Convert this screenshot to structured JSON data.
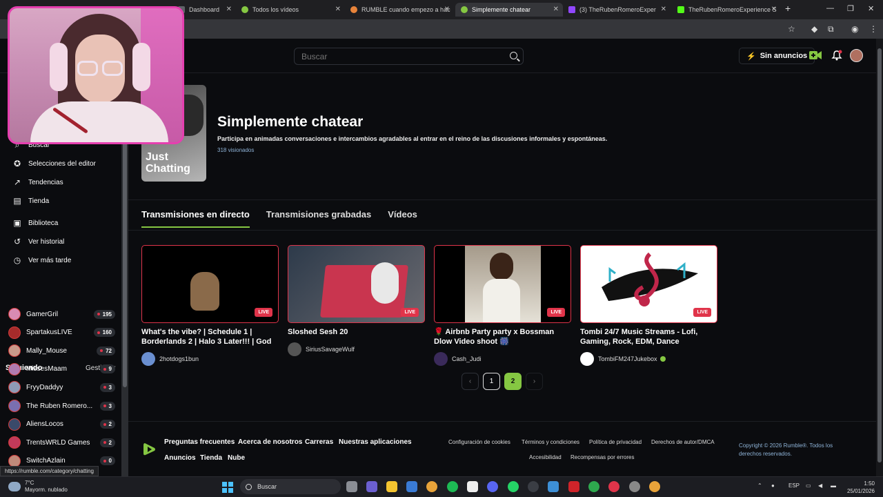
{
  "browser": {
    "tabs": [
      {
        "label": "Dashboard",
        "color": "#5f6368"
      },
      {
        "label": "Todos los vídeos",
        "color": "#85c742"
      },
      {
        "label": "RUMBLE cuando empezo a hac",
        "color": "#e8833a"
      },
      {
        "label": "Simplemente chatear",
        "color": "#85c742"
      },
      {
        "label": "(3) TheRubenRomeroExper",
        "color": "#9147ff"
      },
      {
        "label": "TheRubenRomeroExperience S",
        "color": "#53fc18"
      }
    ],
    "new_tab": "+"
  },
  "header": {
    "search_placeholder": "Buscar",
    "no_ads_label": "Sin anuncios",
    "accent": "#85c742"
  },
  "sidebar": {
    "nav": [
      {
        "label": "Buscar",
        "icon": "search-icon",
        "glyph": "⌕"
      },
      {
        "label": "Selecciones del editor",
        "icon": "ribbon-icon",
        "glyph": "✪"
      },
      {
        "label": "Tendencias",
        "icon": "trending-icon",
        "glyph": "↗"
      },
      {
        "label": "Tienda",
        "icon": "store-icon",
        "glyph": "▤"
      },
      {
        "label": "Biblioteca",
        "icon": "library-icon",
        "glyph": "▣"
      },
      {
        "label": "Ver historial",
        "icon": "history-icon",
        "glyph": "↺"
      },
      {
        "label": "Ver más tarde",
        "icon": "clock-icon",
        "glyph": "◷"
      }
    ],
    "following_title": "Siguiendo",
    "manage_label": "Gestionar",
    "following": [
      {
        "name": "GamerGril",
        "count": "195",
        "color": "#d98bb3"
      },
      {
        "name": "SpartakusLIVE",
        "count": "160",
        "color": "#a62b2b"
      },
      {
        "name": "Mally_Mouse",
        "count": "72",
        "color": "#c99a8a"
      },
      {
        "name": "MissesMaam",
        "count": "9",
        "color": "#b07bb0"
      },
      {
        "name": "FryyDaddyy",
        "count": "3",
        "color": "#8e9bb5"
      },
      {
        "name": "The Ruben Romero...",
        "count": "3",
        "color": "#7a6fb0"
      },
      {
        "name": "AliensLocos",
        "count": "2",
        "color": "#3a4a6a"
      },
      {
        "name": "TrentsWRLD Games",
        "count": "2",
        "color": "#c23a5a"
      },
      {
        "name": "SwitchAzlain",
        "count": "0",
        "color": "#c08a7a"
      }
    ]
  },
  "category": {
    "thumb_label": "Just Chatting",
    "title": "Simplemente chatear",
    "description": "Participa en animadas conversaciones e intercambios agradables al entrar en el reino de las discusiones informales y espontáneas.",
    "views": "318 visionados"
  },
  "tabs": [
    "Transmisiones en directo",
    "Transmisiones grabadas",
    "Vídeos"
  ],
  "cards": [
    {
      "title": "What's the vibe? | Schedule 1 | Borderlands 2 | Halo 3 Later!!! | God i...",
      "channel": "2hotdogs1bun",
      "live": "LIVE",
      "bg": "#000000",
      "avatar": "#6a8fd0"
    },
    {
      "title": "Sloshed Sesh 20",
      "channel": "SiriusSavageWulf",
      "live": "LIVE",
      "bg": "#3a3f48",
      "avatar": "#555555"
    },
    {
      "title": "🌹 Airbnb Party party x Bossman Dlow Video shoot 🎆",
      "channel": "Cash_Judi",
      "live": "LIVE",
      "bg": "#d9d3c5",
      "avatar": "#3a2a5a"
    },
    {
      "title": "Tombi 24/7 Music Streams - Lofi, Gaming, Rock, EDM, Dance",
      "channel": "TombiFM247Jukebox",
      "live": "LIVE",
      "bg": "#ffffff",
      "avatar": "#ffffff"
    }
  ],
  "pager": {
    "prev": "‹",
    "current": "1",
    "next_page": "2",
    "next": "›"
  },
  "footer": {
    "links": [
      "Preguntas frecuentes",
      "Acerca de nosotros",
      "Carreras",
      "Nuestras aplicaciones"
    ],
    "links2": [
      "Anuncios",
      "Tienda",
      "Nube"
    ],
    "legal": [
      "Configuración de cookies",
      "Términos y condiciones",
      "Política de privacidad",
      "Derechos de autor/DMCA"
    ],
    "legal2": [
      "Accesibilidad",
      "Recompensas por errores"
    ],
    "copyright": "Copyright © 2026 Rumble®. Todos los derechos reservados."
  },
  "status_url": "https://rumble.com/category/chatting",
  "taskbar": {
    "temp": "7°C",
    "weather": "Mayorm. nublado",
    "search": "Buscar",
    "lang": "ESP",
    "time": "1:50",
    "date": "25/01/2026"
  }
}
